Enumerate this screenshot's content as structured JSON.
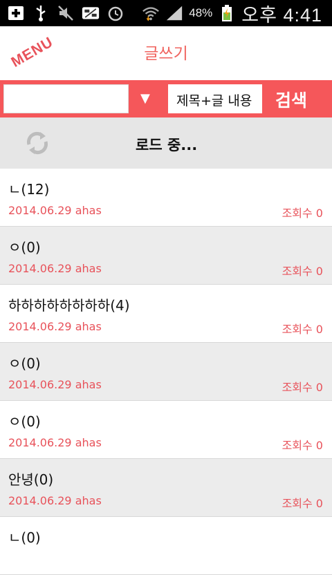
{
  "status_bar": {
    "battery": "48%",
    "time": "오후 4:41",
    "icons": [
      "add-icon",
      "usb-icon",
      "mute-icon",
      "app-notification-icon",
      "alarm-icon",
      "wifi-icon",
      "signal-icon",
      "battery-icon"
    ]
  },
  "header": {
    "menu_label": "MENU",
    "write_label": "글쓰기"
  },
  "search": {
    "input_value": "",
    "filter_selected": "제목+글 내용",
    "button_label": "검색"
  },
  "loading": {
    "text": "로드 중..."
  },
  "posts": [
    {
      "title": "ㄴ(12)",
      "meta": "2014.06.29 ahas",
      "views": "조회수 0"
    },
    {
      "title": "ㅇ(0)",
      "meta": "2014.06.29 ahas",
      "views": "조회수 0"
    },
    {
      "title": "하하하하하하하하(4)",
      "meta": "2014.06.29 ahas",
      "views": "조회수 0"
    },
    {
      "title": "ㅇ(0)",
      "meta": "2014.06.29 ahas",
      "views": "조회수 0"
    },
    {
      "title": "ㅇ(0)",
      "meta": "2014.06.29 ahas",
      "views": "조회수 0"
    },
    {
      "title": "안녕(0)",
      "meta": "2014.06.29 ahas",
      "views": "조회수 0"
    },
    {
      "title": "ㄴ(0)",
      "meta": "",
      "views": ""
    }
  ],
  "colors": {
    "accent": "#f5575a",
    "accent_text": "#e8525a",
    "loading_bg": "#e6e6e6",
    "alt_row_bg": "#ececec"
  }
}
